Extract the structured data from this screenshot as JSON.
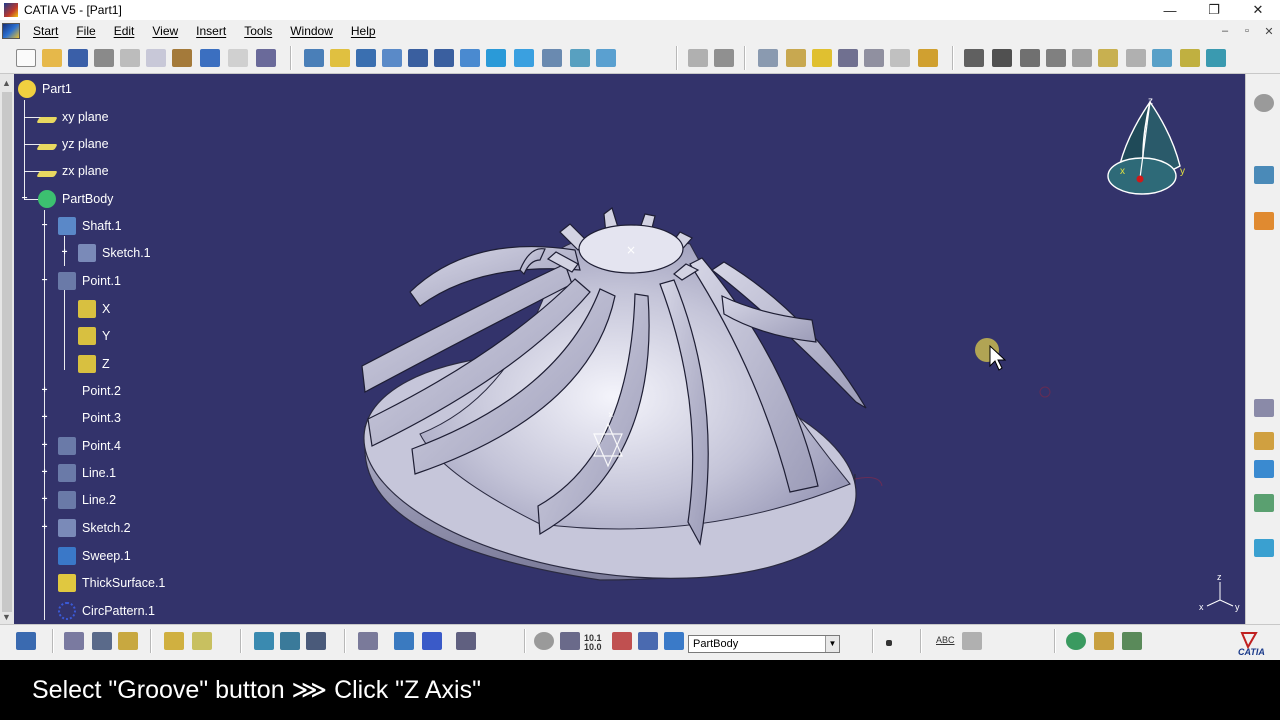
{
  "window": {
    "title": "CATIA V5 - [Part1]",
    "controls": {
      "minimize": "—",
      "restore": "❐",
      "close": "✕"
    }
  },
  "menubar": {
    "items": [
      "Start",
      "File",
      "Edit",
      "View",
      "Insert",
      "Tools",
      "Window",
      "Help"
    ],
    "mdi_controls": [
      "–",
      "▫",
      "✕"
    ]
  },
  "tree": {
    "root": "Part1",
    "items": [
      {
        "label": "xy plane",
        "icon": "plane-icon"
      },
      {
        "label": "yz plane",
        "icon": "plane-icon"
      },
      {
        "label": "zx plane",
        "icon": "plane-icon"
      },
      {
        "label": "PartBody",
        "icon": "body-gear-icon"
      },
      {
        "label": "Shaft.1",
        "icon": "shaft-icon"
      },
      {
        "label": "Sketch.1",
        "icon": "sketch-icon"
      },
      {
        "label": "Point.1",
        "icon": "point-icon"
      },
      {
        "label": "X",
        "icon": "parameter-icon"
      },
      {
        "label": "Y",
        "icon": "parameter-icon"
      },
      {
        "label": "Z",
        "icon": "parameter-icon"
      },
      {
        "label": "Point.2",
        "icon": "point-small-icon"
      },
      {
        "label": "Point.3",
        "icon": "point-small-icon"
      },
      {
        "label": "Point.4",
        "icon": "point-icon"
      },
      {
        "label": "Line.1",
        "icon": "line-icon"
      },
      {
        "label": "Line.2",
        "icon": "line-icon"
      },
      {
        "label": "Sketch.2",
        "icon": "sketch-icon"
      },
      {
        "label": "Sweep.1",
        "icon": "sweep-icon"
      },
      {
        "label": "ThickSurface.1",
        "icon": "thick-surface-icon"
      },
      {
        "label": "CircPattern.1",
        "icon": "circ-pattern-icon"
      }
    ]
  },
  "compass": {
    "axes": [
      "z",
      "x",
      "y"
    ]
  },
  "axis_triad": {
    "labels": [
      "z",
      "x",
      "y"
    ]
  },
  "bottom_toolbar": {
    "current_body": "PartBody",
    "snap_values": "10.1\n10.0",
    "abc_label": "ABC"
  },
  "caption": {
    "text": "Select \"Groove\" button ⋙ Click \"Z Axis\""
  },
  "brand": {
    "logo_text": "CATIA"
  },
  "colors": {
    "viewport_bg": "#33336b",
    "model_fill": "#c9c9dc",
    "tree_text": "#ffffff"
  }
}
